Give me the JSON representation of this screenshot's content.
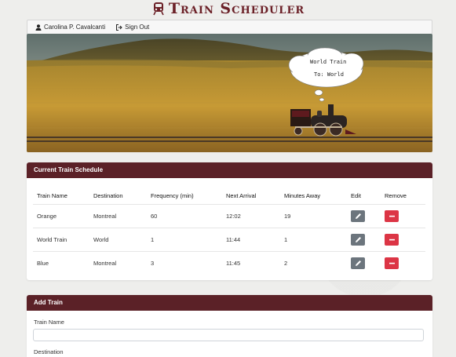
{
  "app": {
    "title": "Train Scheduler"
  },
  "userbar": {
    "user_name": "Carolina P. Cavalcanti",
    "signout_label": "Sign Out"
  },
  "hero": {
    "bubble_line1": "World Train",
    "bubble_line2": "To: World"
  },
  "schedule": {
    "header": "Current Train Schedule",
    "columns": [
      "Train Name",
      "Destination",
      "Frequency (min)",
      "Next Arrival",
      "Minutes Away",
      "Edit",
      "Remove"
    ],
    "rows": [
      [
        "Orange",
        "Montreal",
        "60",
        "12:02",
        "19"
      ],
      [
        "World Train",
        "World",
        "1",
        "11:44",
        "1"
      ],
      [
        "Blue",
        "Montreal",
        "3",
        "11:45",
        "2"
      ]
    ]
  },
  "add_train": {
    "header": "Add Train",
    "train_name_label": "Train Name",
    "train_name_value": "",
    "destination_label": "Destination"
  },
  "colors": {
    "brand": "#5b2127",
    "edit": "#6c757d",
    "remove": "#dc3545"
  },
  "icons": {
    "logo": "train-icon",
    "user": "user-icon",
    "signout": "sign-out-icon",
    "edit": "pencil-icon",
    "remove": "minus-icon"
  }
}
